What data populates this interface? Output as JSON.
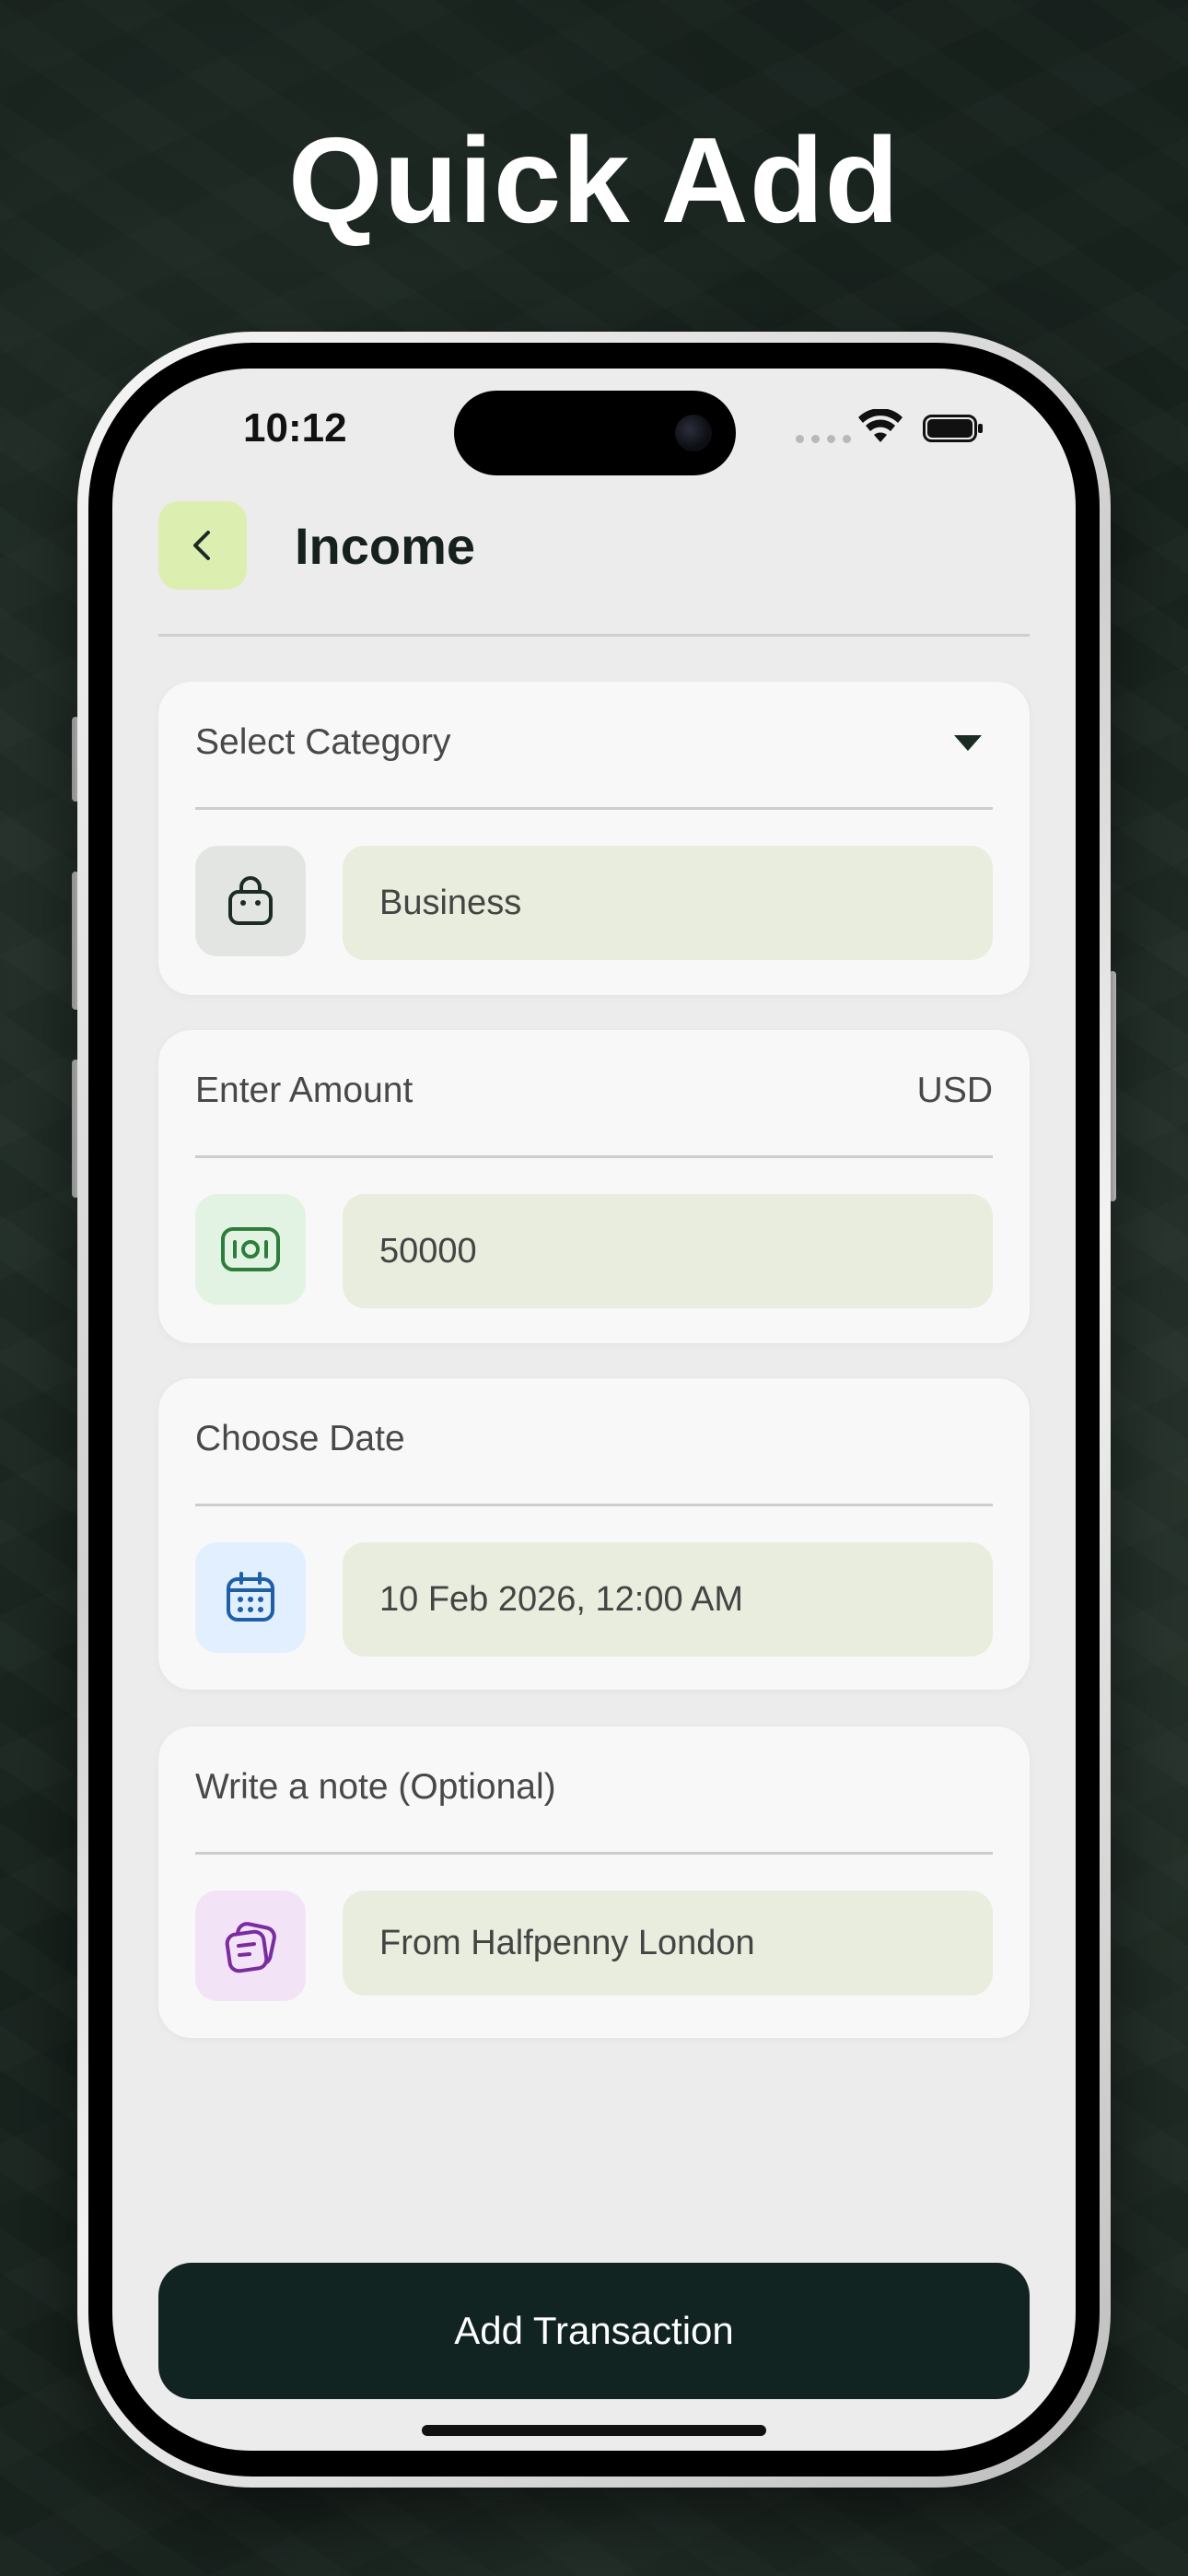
{
  "banner": {
    "headline": "Quick Add"
  },
  "status_bar": {
    "time": "10:12",
    "icons": [
      "signal-dots-icon",
      "wifi-icon",
      "battery-icon"
    ]
  },
  "header": {
    "back_icon": "chevron-left-icon",
    "title": "Income"
  },
  "category_card": {
    "label": "Select Category",
    "dropdown_icon": "caret-down-icon",
    "icon": "shopping-bag-icon",
    "value": "Business"
  },
  "amount_card": {
    "label": "Enter Amount",
    "currency": "USD",
    "icon": "banknote-icon",
    "value": "50000"
  },
  "date_card": {
    "label": "Choose Date",
    "icon": "calendar-icon",
    "value": "10 Feb 2026, 12:00 AM"
  },
  "note_card": {
    "label": "Write a note (Optional)",
    "icon": "note-icon",
    "value": "From Halfpenny London"
  },
  "actions": {
    "submit_label": "Add Transaction"
  },
  "colors": {
    "accent_green": "#dceeb0",
    "field_bg": "#e8eddd",
    "primary_button": "#112422",
    "money_icon": "#2e7d3a",
    "calendar_icon": "#1e5fa8",
    "note_icon": "#7b2ca0"
  }
}
